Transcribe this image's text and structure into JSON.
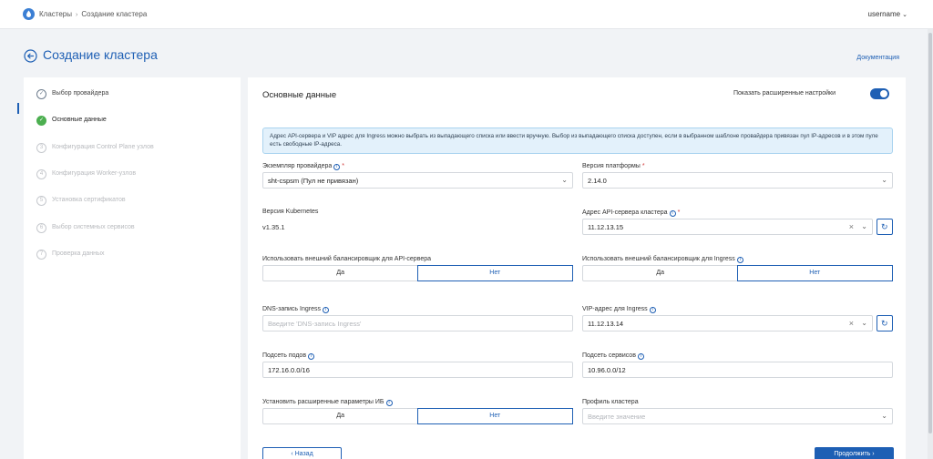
{
  "header": {
    "breadcrumbs": [
      "Кластеры",
      "Создание кластера"
    ],
    "user": "username",
    "logo_icon": "drop-logo-icon",
    "accent": "#1e5fb4"
  },
  "page": {
    "title": "Создание кластера",
    "doc_link": "Документация"
  },
  "steps": [
    {
      "num": "✓",
      "label": "Выбор провайдера",
      "state": "done"
    },
    {
      "num": "✓",
      "label": "Основные данные",
      "state": "active"
    },
    {
      "num": "3",
      "label": "Конфигурация Control Plane узлов",
      "state": "todo"
    },
    {
      "num": "4",
      "label": "Конфигурация Worker-узлов",
      "state": "todo"
    },
    {
      "num": "5",
      "label": "Установка сертификатов",
      "state": "todo"
    },
    {
      "num": "6",
      "label": "Выбор системных сервисов",
      "state": "todo"
    },
    {
      "num": "7",
      "label": "Проверка данных",
      "state": "todo"
    }
  ],
  "form": {
    "section_title": "Основные данные",
    "advanced_label": "Показать расширенные настройки",
    "advanced_enabled": true,
    "info_text": "Адрес API-сервера и VIP адрес для Ingress можно выбрать из выпадающего списка или ввести вручную. Выбор из выпадающего списка доступен, если в выбранном шаблоне провайдера привязан пул IP-адресов и в этом пуле есть свободные IP-адреса.",
    "provider_instance": {
      "label": "Экземпляр провайдера",
      "value": "sht-cspsm (Пул не привязан)"
    },
    "platform_version": {
      "label": "Версия платформы",
      "value": "2.14.0"
    },
    "k8s_version": {
      "label": "Версия Kubernetes",
      "value": "v1.35.1"
    },
    "api_address": {
      "label": "Адрес API-сервера кластера",
      "value": "11.12.13.15"
    },
    "ext_balancer_api": {
      "label": "Использовать внешний балансировщик для API-сервера",
      "options": [
        "Да",
        "Нет"
      ],
      "selected": "Нет"
    },
    "ext_balancer_ingress": {
      "label": "Использовать внешний балансировщик для Ingress",
      "options": [
        "Да",
        "Нет"
      ],
      "selected": "Нет"
    },
    "dns_ingress": {
      "label": "DNS-запись Ingress",
      "placeholder": "Введите 'DNS-запись Ingress'"
    },
    "vip_ingress": {
      "label": "VIP-адрес для Ingress",
      "value": "11.12.13.14"
    },
    "pods_subnet": {
      "label": "Подсеть подов",
      "value": "172.16.0.0/16"
    },
    "services_subnet": {
      "label": "Подсеть сервисов",
      "value": "10.96.0.0/12"
    },
    "extended_ib": {
      "label": "Установить расширенные параметры ИБ",
      "options": [
        "Да",
        "Нет"
      ],
      "selected": "Нет"
    },
    "cluster_profile": {
      "label": "Профиль кластера",
      "placeholder": "Введите значение"
    }
  },
  "actions": {
    "back": "‹  Назад",
    "next": "Продолжить  ›"
  }
}
